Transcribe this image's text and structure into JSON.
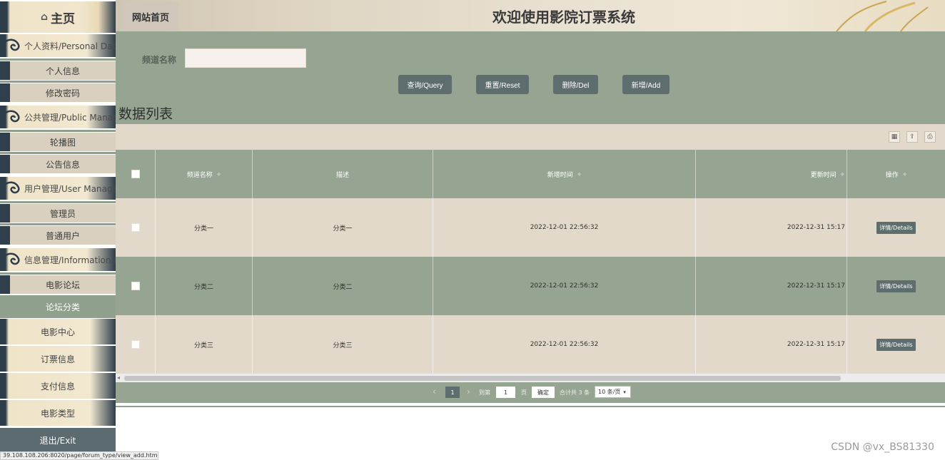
{
  "sidebar": {
    "home": "主页",
    "sections": {
      "personal": "个人资料/Personal Data",
      "public": "公共管理/Public Manage",
      "user": "用户管理/User Manage",
      "info": "信息管理/Information Ma"
    },
    "items": {
      "personal_info": "个人信息",
      "change_password": "修改密码",
      "carousel": "轮播图",
      "notice": "公告信息",
      "admin": "管理员",
      "normal_user": "普通用户",
      "movie_forum": "电影论坛",
      "forum_category": "论坛分类"
    },
    "big": {
      "movie_center": "电影中心",
      "ticket_info": "订票信息",
      "payment_info": "支付信息",
      "movie_type": "电影类型"
    },
    "exit": "退出/Exit"
  },
  "header": {
    "crumb": "网站首页",
    "title": "欢迎使用影院订票系统"
  },
  "search": {
    "channel_label": "频道名称",
    "channel_value": "",
    "buttons": {
      "query": "查询/Query",
      "reset": "重置/Reset",
      "delete": "删除/Del",
      "add": "新增/Add"
    }
  },
  "list_title": "数据列表",
  "table": {
    "headers": [
      "频道名称",
      "描述",
      "新增时间",
      "更新时间",
      "操作"
    ],
    "rows": [
      {
        "name": "分类一",
        "desc": "分类一",
        "created": "2022-12-01 22:56:32",
        "updated": "2022-12-31 15:17",
        "action": "详情/Details"
      },
      {
        "name": "分类二",
        "desc": "分类二",
        "created": "2022-12-01 22:56:32",
        "updated": "2022-12-31 15:17",
        "action": "详情/Details"
      },
      {
        "name": "分类三",
        "desc": "分类三",
        "created": "2022-12-01 22:56:32",
        "updated": "2022-12-31 15:17",
        "action": "详情/Details"
      }
    ]
  },
  "pager": {
    "current": "1",
    "goto_label": "到第",
    "goto_value": "1",
    "page_unit": "页",
    "confirm": "确定",
    "total": "合计共 3 条",
    "page_size": "10 条/页"
  },
  "status_url": "39.108.108.206:8020/page/forum_type/view_add.html",
  "watermark": "CSDN @vx_BS81330",
  "colors": {
    "sage": "#96a591",
    "beige": "#e3d9cb",
    "button": "#5e6e6e",
    "navy": "#2e3d4a"
  }
}
